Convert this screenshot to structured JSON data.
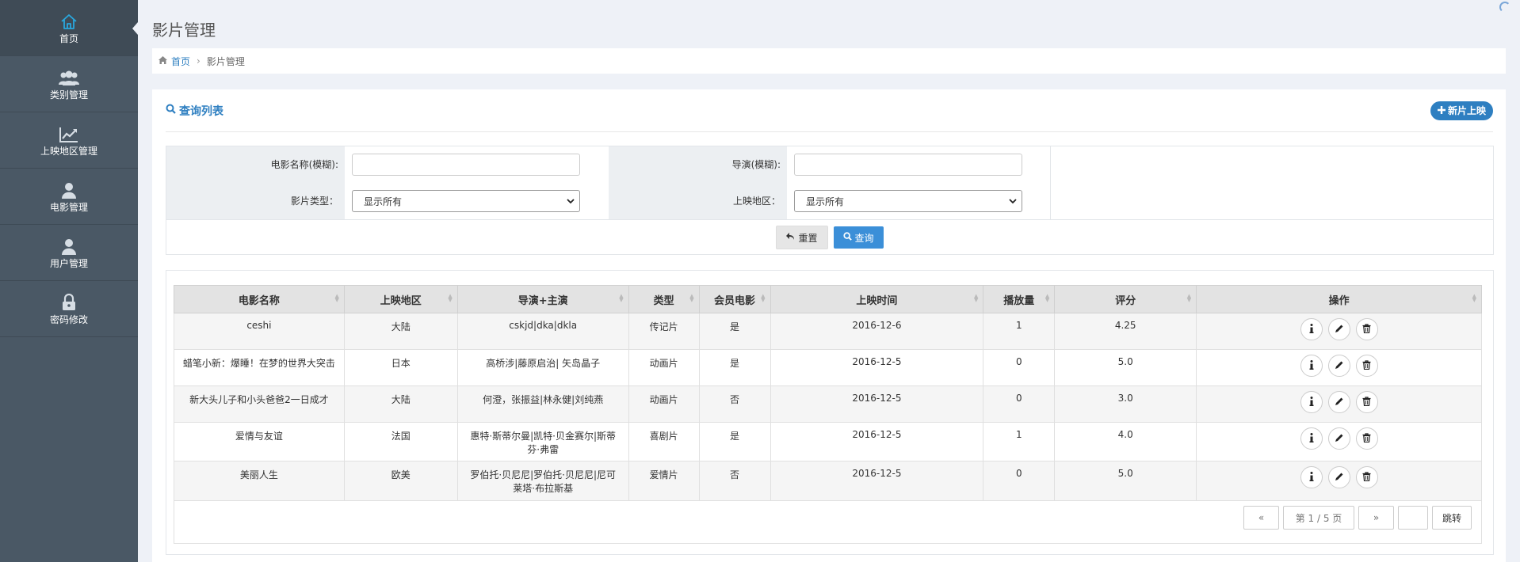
{
  "sidebar": {
    "items": [
      {
        "label": "首页",
        "icon": "home-icon",
        "active": true
      },
      {
        "label": "类别管理",
        "icon": "users-icon"
      },
      {
        "label": "上映地区管理",
        "icon": "chart-line-icon"
      },
      {
        "label": "电影管理",
        "icon": "user-icon"
      },
      {
        "label": "用户管理",
        "icon": "user-icon"
      },
      {
        "label": "密码修改",
        "icon": "lock-icon"
      }
    ]
  },
  "page": {
    "title": "影片管理"
  },
  "breadcrumb": {
    "home": "首页",
    "current": "影片管理"
  },
  "panel": {
    "title": "查询列表",
    "new_button": "新片上映"
  },
  "search": {
    "name_label": "电影名称(模糊):",
    "name_value": "",
    "director_label": "导演(模糊):",
    "director_value": "",
    "type_label": "影片类型：",
    "type_value": "显示所有",
    "region_label": "上映地区：",
    "region_value": "显示所有",
    "reset_button": "重置",
    "query_button": "查询"
  },
  "table": {
    "headers": [
      "电影名称",
      "上映地区",
      "导演+主演",
      "类型",
      "会员电影",
      "上映时间",
      "播放量",
      "评分",
      "操作"
    ],
    "rows": [
      {
        "name": "ceshi",
        "region": "大陆",
        "cast": "cskjd|dka|dkla",
        "type": "传记片",
        "member": "是",
        "date": "2016-12-6",
        "plays": "1",
        "score": "4.25"
      },
      {
        "name": "蜡笔小新：爆睡！在梦的世界大突击",
        "region": "日本",
        "cast": "高桥涉|藤原启治| 矢岛晶子",
        "type": "动画片",
        "member": "是",
        "date": "2016-12-5",
        "plays": "0",
        "score": "5.0"
      },
      {
        "name": "新大头儿子和小头爸爸2一日成才",
        "region": "大陆",
        "cast": "何澄，张振益|林永健|刘纯燕",
        "type": "动画片",
        "member": "否",
        "date": "2016-12-5",
        "plays": "0",
        "score": "3.0"
      },
      {
        "name": "爱情与友谊",
        "region": "法国",
        "cast": "惠特·斯蒂尔曼|凯特·贝金赛尔|斯蒂芬·弗雷",
        "type": "喜剧片",
        "member": "是",
        "date": "2016-12-5",
        "plays": "1",
        "score": "4.0"
      },
      {
        "name": "美丽人生",
        "region": "欧美",
        "cast": "罗伯托·贝尼尼|罗伯托·贝尼尼|尼可莱塔·布拉斯基",
        "type": "爱情片",
        "member": "否",
        "date": "2016-12-5",
        "plays": "0",
        "score": "5.0"
      }
    ]
  },
  "pager": {
    "prev": "«",
    "info": "第 1 / 5 页",
    "next": "»",
    "jump_value": "",
    "jump_button": "跳转"
  },
  "colors": {
    "sidebar": "#4a5865",
    "accent": "#2e7fc1",
    "yes": "#d9302c",
    "no": "#2f9a3f"
  }
}
